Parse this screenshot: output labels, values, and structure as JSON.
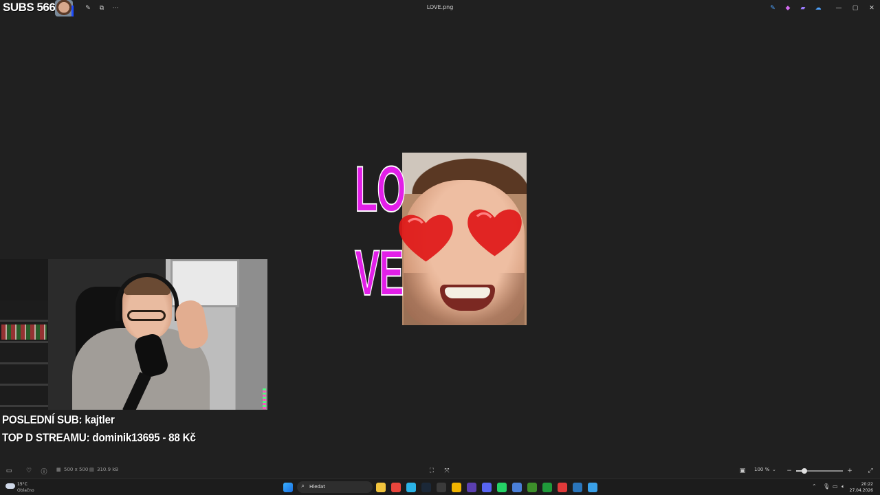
{
  "window": {
    "title": "LOVE.png",
    "toolbar_icons": [
      "gallery-icon",
      "edit-icon",
      "share-icon",
      "more-icon"
    ],
    "extension_icons": [
      "edit-pen-icon",
      "copilot-icon",
      "clipchamp-icon",
      "onedrive-icon"
    ],
    "controls": {
      "minimize": "—",
      "maximize": "▢",
      "close": "✕"
    }
  },
  "overlay": {
    "subs_counter": "SUBS 566/",
    "last_sub": "POSLEDNÍ SUB: kajtler",
    "top_donation": "TOP D STREAMU: dominik13695 - 88 Kč"
  },
  "image": {
    "love_line1": "LO",
    "love_line2": "VE",
    "text_color": "#e21fe8",
    "glasses_color": "#e01818"
  },
  "statusbar": {
    "dimensions": "500 x 500",
    "file_size": "310.9 kB",
    "zoom": "100 %",
    "zoom_level": 0.18
  },
  "taskbar": {
    "weather_temp": "15°C",
    "weather_desc": "Oblačno",
    "search_placeholder": "Hledat",
    "time": "20:22",
    "date": "27.04.2026",
    "apps": [
      {
        "name": "file-explorer-icon",
        "color": "#f2c43d"
      },
      {
        "name": "chrome-icon",
        "color": "#e8453c"
      },
      {
        "name": "edge-icon",
        "color": "#2bb3e6"
      },
      {
        "name": "steam-icon",
        "color": "#1b2838"
      },
      {
        "name": "obs-icon",
        "color": "#3a3a3a"
      },
      {
        "name": "app-yellow-icon",
        "color": "#f0b400"
      },
      {
        "name": "app-purple-icon",
        "color": "#5b3fb0"
      },
      {
        "name": "discord-icon",
        "color": "#5865f2"
      },
      {
        "name": "whatsapp-icon",
        "color": "#25d366"
      },
      {
        "name": "app-blue-icon",
        "color": "#4a7fd8"
      },
      {
        "name": "minecraft-icon",
        "color": "#3d8f2a"
      },
      {
        "name": "xbox-icon",
        "color": "#1f9a3a"
      },
      {
        "name": "acrobat-icon",
        "color": "#e03a3a"
      },
      {
        "name": "steam2-icon",
        "color": "#2a75bb"
      },
      {
        "name": "photos-icon",
        "color": "#3aa0e8"
      }
    ]
  }
}
